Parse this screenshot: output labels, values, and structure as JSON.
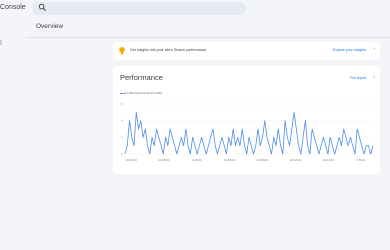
{
  "header": {
    "brand": "Console"
  },
  "page": {
    "title": "Overview"
  },
  "insights": {
    "text": "Get insights into your site's Search performance",
    "link": "Explore your insights"
  },
  "performance": {
    "title": "Performance",
    "link": "Full report",
    "legend": "■ 1,250 total web search clicks"
  },
  "colors": {
    "accent": "#1a73e8",
    "series": "#4b8ee8"
  },
  "chart_data": {
    "type": "line",
    "ylim": [
      0,
      6
    ],
    "y_ticks": [
      "6",
      "4",
      "2",
      "0"
    ],
    "x_ticks": [
      "10/13/23",
      "10/25/23",
      "11/6/23",
      "11/18/23",
      "11/30/23",
      "12/12/23",
      "12/24/23",
      "1/5/24"
    ],
    "series": [
      {
        "values": [
          0,
          1,
          4,
          2,
          1,
          5,
          3,
          4,
          2,
          3,
          1,
          0,
          2,
          1,
          3,
          2,
          1,
          0,
          2,
          1,
          3,
          2,
          1,
          0,
          1,
          2,
          1,
          3,
          1,
          0,
          2,
          1,
          0,
          1,
          2,
          1,
          0,
          1,
          2,
          3,
          1,
          0,
          1,
          2,
          1,
          0,
          2,
          1,
          3,
          1,
          2,
          1,
          3,
          1,
          0,
          2,
          1,
          0,
          1,
          3,
          1,
          2,
          4,
          2,
          1,
          0,
          2,
          1,
          3,
          1,
          0,
          4,
          2,
          1,
          3,
          5,
          3,
          1,
          0,
          2,
          4,
          1,
          0,
          3,
          2,
          1,
          0,
          1,
          2,
          1,
          0,
          2,
          1,
          0,
          1,
          2,
          1,
          3,
          2,
          1,
          2,
          1,
          0,
          3,
          2,
          1,
          0,
          1,
          1,
          0,
          1
        ]
      }
    ]
  }
}
